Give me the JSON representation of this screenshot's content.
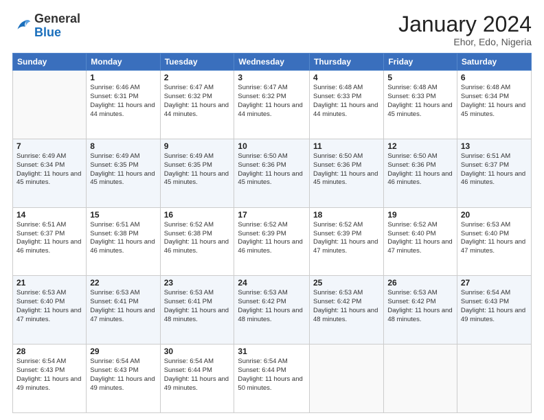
{
  "header": {
    "logo_general": "General",
    "logo_blue": "Blue",
    "month_year": "January 2024",
    "location": "Ehor, Edo, Nigeria"
  },
  "days_of_week": [
    "Sunday",
    "Monday",
    "Tuesday",
    "Wednesday",
    "Thursday",
    "Friday",
    "Saturday"
  ],
  "weeks": [
    [
      {
        "day": "",
        "sunrise": "",
        "sunset": "",
        "daylight": ""
      },
      {
        "day": "1",
        "sunrise": "Sunrise: 6:46 AM",
        "sunset": "Sunset: 6:31 PM",
        "daylight": "Daylight: 11 hours and 44 minutes."
      },
      {
        "day": "2",
        "sunrise": "Sunrise: 6:47 AM",
        "sunset": "Sunset: 6:32 PM",
        "daylight": "Daylight: 11 hours and 44 minutes."
      },
      {
        "day": "3",
        "sunrise": "Sunrise: 6:47 AM",
        "sunset": "Sunset: 6:32 PM",
        "daylight": "Daylight: 11 hours and 44 minutes."
      },
      {
        "day": "4",
        "sunrise": "Sunrise: 6:48 AM",
        "sunset": "Sunset: 6:33 PM",
        "daylight": "Daylight: 11 hours and 44 minutes."
      },
      {
        "day": "5",
        "sunrise": "Sunrise: 6:48 AM",
        "sunset": "Sunset: 6:33 PM",
        "daylight": "Daylight: 11 hours and 45 minutes."
      },
      {
        "day": "6",
        "sunrise": "Sunrise: 6:48 AM",
        "sunset": "Sunset: 6:34 PM",
        "daylight": "Daylight: 11 hours and 45 minutes."
      }
    ],
    [
      {
        "day": "7",
        "sunrise": "Sunrise: 6:49 AM",
        "sunset": "Sunset: 6:34 PM",
        "daylight": "Daylight: 11 hours and 45 minutes."
      },
      {
        "day": "8",
        "sunrise": "Sunrise: 6:49 AM",
        "sunset": "Sunset: 6:35 PM",
        "daylight": "Daylight: 11 hours and 45 minutes."
      },
      {
        "day": "9",
        "sunrise": "Sunrise: 6:49 AM",
        "sunset": "Sunset: 6:35 PM",
        "daylight": "Daylight: 11 hours and 45 minutes."
      },
      {
        "day": "10",
        "sunrise": "Sunrise: 6:50 AM",
        "sunset": "Sunset: 6:36 PM",
        "daylight": "Daylight: 11 hours and 45 minutes."
      },
      {
        "day": "11",
        "sunrise": "Sunrise: 6:50 AM",
        "sunset": "Sunset: 6:36 PM",
        "daylight": "Daylight: 11 hours and 45 minutes."
      },
      {
        "day": "12",
        "sunrise": "Sunrise: 6:50 AM",
        "sunset": "Sunset: 6:36 PM",
        "daylight": "Daylight: 11 hours and 46 minutes."
      },
      {
        "day": "13",
        "sunrise": "Sunrise: 6:51 AM",
        "sunset": "Sunset: 6:37 PM",
        "daylight": "Daylight: 11 hours and 46 minutes."
      }
    ],
    [
      {
        "day": "14",
        "sunrise": "Sunrise: 6:51 AM",
        "sunset": "Sunset: 6:37 PM",
        "daylight": "Daylight: 11 hours and 46 minutes."
      },
      {
        "day": "15",
        "sunrise": "Sunrise: 6:51 AM",
        "sunset": "Sunset: 6:38 PM",
        "daylight": "Daylight: 11 hours and 46 minutes."
      },
      {
        "day": "16",
        "sunrise": "Sunrise: 6:52 AM",
        "sunset": "Sunset: 6:38 PM",
        "daylight": "Daylight: 11 hours and 46 minutes."
      },
      {
        "day": "17",
        "sunrise": "Sunrise: 6:52 AM",
        "sunset": "Sunset: 6:39 PM",
        "daylight": "Daylight: 11 hours and 46 minutes."
      },
      {
        "day": "18",
        "sunrise": "Sunrise: 6:52 AM",
        "sunset": "Sunset: 6:39 PM",
        "daylight": "Daylight: 11 hours and 47 minutes."
      },
      {
        "day": "19",
        "sunrise": "Sunrise: 6:52 AM",
        "sunset": "Sunset: 6:40 PM",
        "daylight": "Daylight: 11 hours and 47 minutes."
      },
      {
        "day": "20",
        "sunrise": "Sunrise: 6:53 AM",
        "sunset": "Sunset: 6:40 PM",
        "daylight": "Daylight: 11 hours and 47 minutes."
      }
    ],
    [
      {
        "day": "21",
        "sunrise": "Sunrise: 6:53 AM",
        "sunset": "Sunset: 6:40 PM",
        "daylight": "Daylight: 11 hours and 47 minutes."
      },
      {
        "day": "22",
        "sunrise": "Sunrise: 6:53 AM",
        "sunset": "Sunset: 6:41 PM",
        "daylight": "Daylight: 11 hours and 47 minutes."
      },
      {
        "day": "23",
        "sunrise": "Sunrise: 6:53 AM",
        "sunset": "Sunset: 6:41 PM",
        "daylight": "Daylight: 11 hours and 48 minutes."
      },
      {
        "day": "24",
        "sunrise": "Sunrise: 6:53 AM",
        "sunset": "Sunset: 6:42 PM",
        "daylight": "Daylight: 11 hours and 48 minutes."
      },
      {
        "day": "25",
        "sunrise": "Sunrise: 6:53 AM",
        "sunset": "Sunset: 6:42 PM",
        "daylight": "Daylight: 11 hours and 48 minutes."
      },
      {
        "day": "26",
        "sunrise": "Sunrise: 6:53 AM",
        "sunset": "Sunset: 6:42 PM",
        "daylight": "Daylight: 11 hours and 48 minutes."
      },
      {
        "day": "27",
        "sunrise": "Sunrise: 6:54 AM",
        "sunset": "Sunset: 6:43 PM",
        "daylight": "Daylight: 11 hours and 49 minutes."
      }
    ],
    [
      {
        "day": "28",
        "sunrise": "Sunrise: 6:54 AM",
        "sunset": "Sunset: 6:43 PM",
        "daylight": "Daylight: 11 hours and 49 minutes."
      },
      {
        "day": "29",
        "sunrise": "Sunrise: 6:54 AM",
        "sunset": "Sunset: 6:43 PM",
        "daylight": "Daylight: 11 hours and 49 minutes."
      },
      {
        "day": "30",
        "sunrise": "Sunrise: 6:54 AM",
        "sunset": "Sunset: 6:44 PM",
        "daylight": "Daylight: 11 hours and 49 minutes."
      },
      {
        "day": "31",
        "sunrise": "Sunrise: 6:54 AM",
        "sunset": "Sunset: 6:44 PM",
        "daylight": "Daylight: 11 hours and 50 minutes."
      },
      {
        "day": "",
        "sunrise": "",
        "sunset": "",
        "daylight": ""
      },
      {
        "day": "",
        "sunrise": "",
        "sunset": "",
        "daylight": ""
      },
      {
        "day": "",
        "sunrise": "",
        "sunset": "",
        "daylight": ""
      }
    ]
  ]
}
